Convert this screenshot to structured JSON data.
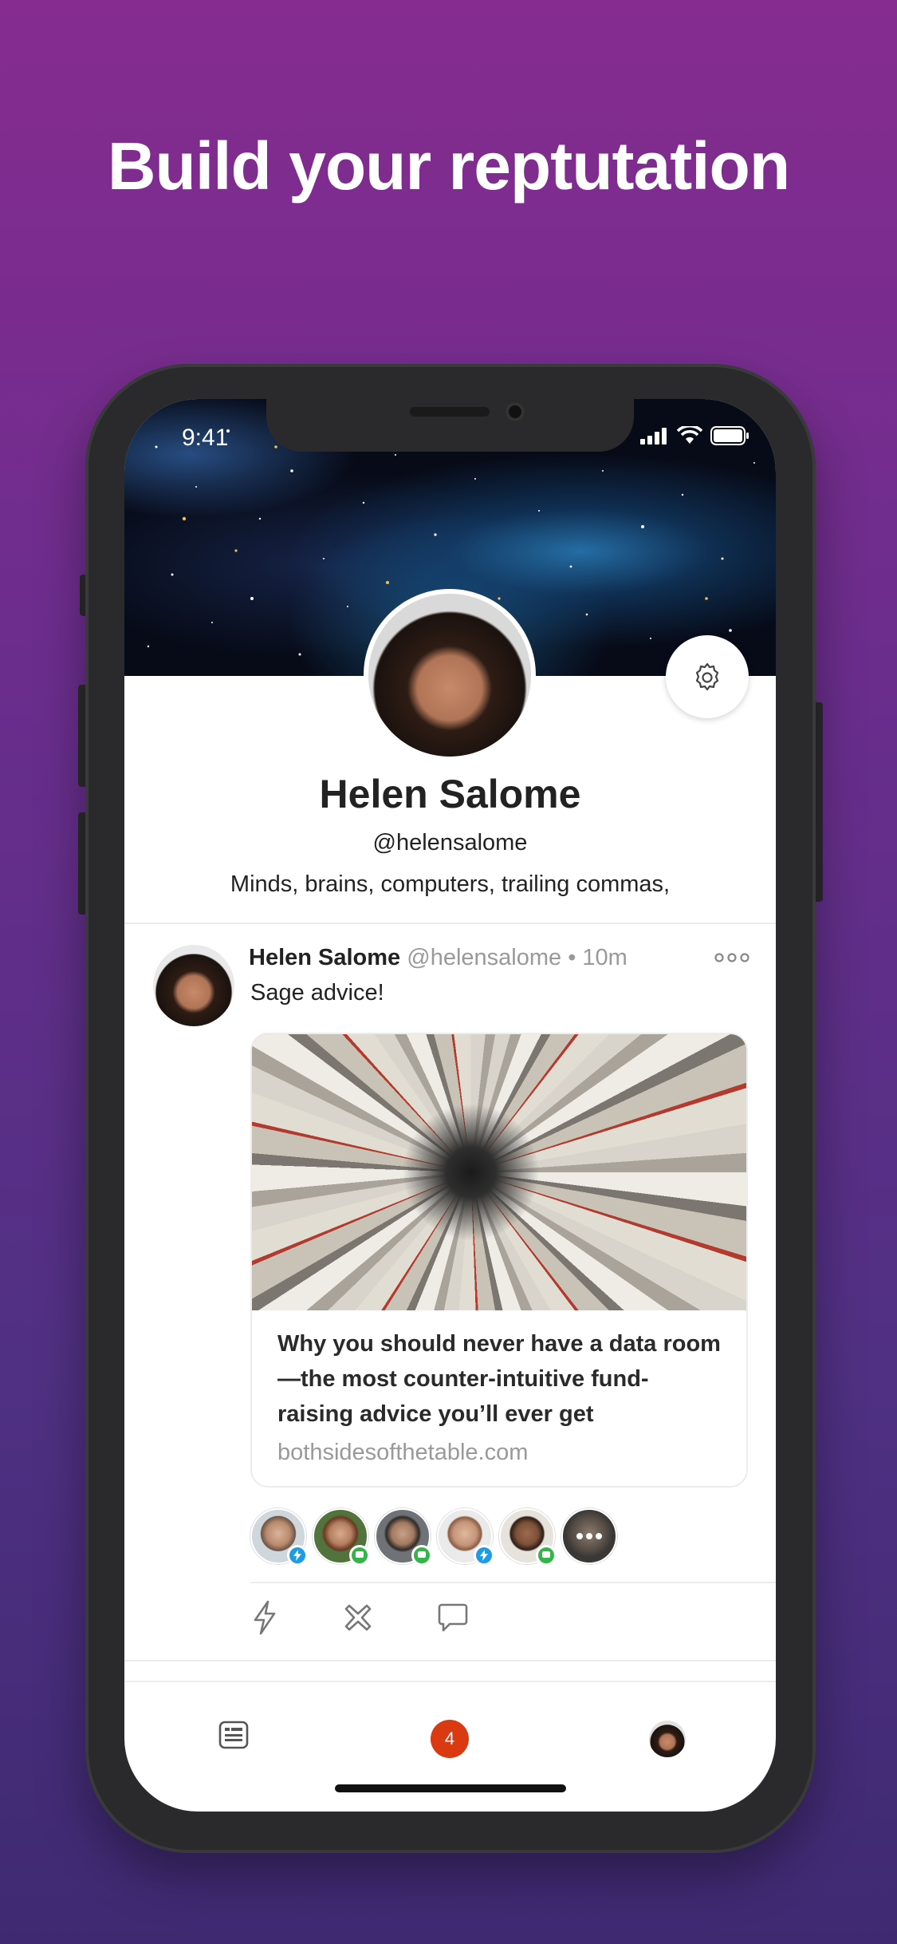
{
  "headline": "Build your reptutation",
  "status_bar": {
    "time": "9:41"
  },
  "profile": {
    "name": "Helen Salome",
    "handle": "@helensalome",
    "bio": "Minds, brains, computers, trailing commas,"
  },
  "post": {
    "author": "Helen Salome",
    "handle": "@helensalome",
    "separator": "•",
    "time": "10m",
    "text": "Sage advice!",
    "link": {
      "title": "Why you should never have a data room—the most counter-intuitive fund-raising advice you’ll ever get",
      "domain": "bothsidesofthetable.com"
    },
    "reactors": [
      {
        "badge": "lightning-icon",
        "color": "#1e9ae6"
      },
      {
        "badge": "message-icon",
        "color": "#34b44a"
      },
      {
        "badge": "message-icon",
        "color": "#34b44a"
      },
      {
        "badge": "lightning-icon",
        "color": "#1e9ae6"
      },
      {
        "badge": "message-icon",
        "color": "#34b44a"
      },
      {
        "badge": "more-icon",
        "color": "#555555"
      }
    ]
  },
  "tabbar": {
    "notifications_count": "4"
  },
  "colors": {
    "accent_badge": "#d93a12",
    "background_top": "#862c90",
    "background_bottom": "#3f2a72"
  }
}
